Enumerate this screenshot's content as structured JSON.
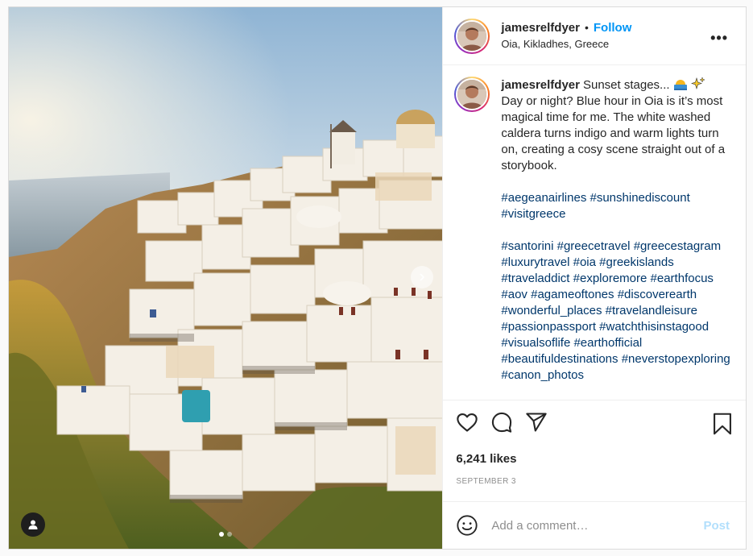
{
  "post": {
    "username": "jamesrelfdyer",
    "bullet": "•",
    "follow_label": "Follow",
    "location": "Oia, Kikladhes, Greece",
    "more_label": "•••",
    "caption": {
      "text_lines": [
        "Sunset stages...",
        "Day or night? Blue hour in Oia is it’s most magical time for me. The white washed caldera turns indigo and warm lights turn on, creating a cosy scene straight out of a storybook."
      ],
      "hashtags_group1": [
        "#aegeanairlines",
        "#sunshinediscount",
        "#visitgreece"
      ],
      "hashtags_group2": [
        "#santorini",
        "#greecetravel",
        "#greecestagram",
        "#luxurytravel",
        "#oia",
        "#greekislands",
        "#traveladdict",
        "#exploremore",
        "#earthfocus",
        "#aov",
        "#agameoftones",
        "#discoverearth",
        "#wonderful_places",
        "#travelandleisure",
        "#passionpassport",
        "#watchthisinstagood",
        "#visualsoflife",
        "#earthofficial",
        "#beautifuldestinations",
        "#neverstopexploring",
        "#canon_photos"
      ]
    },
    "likes": "6,241 likes",
    "date": "SEPTEMBER 3",
    "comment_placeholder": "Add a comment…",
    "post_button": "Post",
    "carousel": {
      "slides": 2,
      "active": 1
    }
  },
  "colors": {
    "accent": "#0095f6",
    "hashtag": "#00376b",
    "muted": "#8e8e8e",
    "post_disabled": "#b2dffc"
  },
  "icons": {
    "heart": "heart-icon",
    "comment": "comment-icon",
    "share": "share-icon",
    "save": "bookmark-icon",
    "emoji": "smiley-icon",
    "tag": "user-tag-icon",
    "next": "chevron-right-icon",
    "more": "more-options-icon"
  }
}
